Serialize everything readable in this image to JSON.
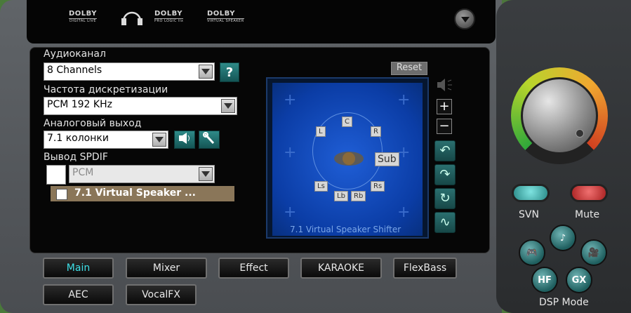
{
  "logos": [
    {
      "name": "DOLBY",
      "sub": "DIGITAL LIVE"
    },
    {
      "name": "DOLBY",
      "sub": "PRO LOGIC IIx"
    },
    {
      "name": "DOLBY",
      "sub": "VIRTUAL SPEAKER"
    }
  ],
  "audio_channel": {
    "label": "Аудиоканал",
    "value": "8 Channels",
    "help": "?"
  },
  "sample_rate": {
    "label": "Частота дискретизации",
    "value": "PCM 192 KHz"
  },
  "analog_out": {
    "label": "Аналоговый выход",
    "value": "7.1 колонки"
  },
  "spdif": {
    "label": "Вывод SPDIF",
    "value": "PCM"
  },
  "virtual_speaker": {
    "label": "7.1 Virtual Speaker ..."
  },
  "speaker_panel": {
    "reset": "Reset",
    "caption": "7.1 Virtual Speaker Shifter",
    "speakers": {
      "c": "C",
      "l": "L",
      "r": "R",
      "ls": "Ls",
      "rs": "Rs",
      "lb": "Lb",
      "rb": "Rb",
      "sub": "Sub"
    },
    "plus": "+",
    "minus": "−"
  },
  "tabs": [
    {
      "label": "Main",
      "active": true
    },
    {
      "label": "Mixer"
    },
    {
      "label": "Effect"
    },
    {
      "label": "KARAOKE"
    },
    {
      "label": "FlexBass"
    },
    {
      "label": "AEC"
    },
    {
      "label": "VocalFX"
    }
  ],
  "right": {
    "svn": "SVN",
    "mute": "Mute",
    "dsp_mode": "DSP Mode",
    "dsp_buttons": {
      "hf": "HF",
      "gx": "GX"
    }
  },
  "colors": {
    "accent": "#3ee0e8",
    "svn": "#3aa7a6",
    "mute": "#d23a3a"
  }
}
